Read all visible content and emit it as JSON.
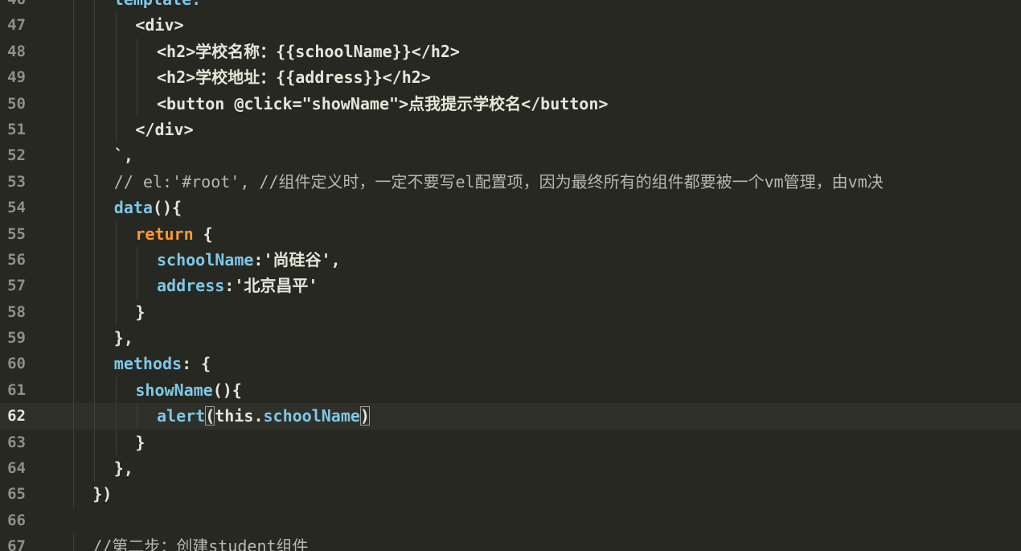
{
  "editor": {
    "active_line": "62",
    "lines": [
      {
        "n": "46",
        "indent": 3,
        "segments": [
          {
            "t": "template:`",
            "c": "prop"
          }
        ]
      },
      {
        "n": "47",
        "indent": 4,
        "segments": [
          {
            "t": "<div>",
            "c": "tag"
          }
        ]
      },
      {
        "n": "48",
        "indent": 5,
        "segments": [
          {
            "t": "<h2>学校名称：{{schoolName}}</h2>",
            "c": "tag"
          }
        ]
      },
      {
        "n": "49",
        "indent": 5,
        "segments": [
          {
            "t": "<h2>学校地址：{{address}}</h2>",
            "c": "tag"
          }
        ]
      },
      {
        "n": "50",
        "indent": 5,
        "segments": [
          {
            "t": "<button @click=\"showName\">点我提示学校名</button>",
            "c": "tag"
          }
        ]
      },
      {
        "n": "51",
        "indent": 4,
        "segments": [
          {
            "t": "</div>",
            "c": "tag"
          }
        ]
      },
      {
        "n": "52",
        "indent": 3,
        "segments": [
          {
            "t": "`,",
            "c": "str"
          }
        ]
      },
      {
        "n": "53",
        "indent": 3,
        "segments": [
          {
            "t": "// el:'#root', //组件定义时，一定不要写el配置项，因为最终所有的组件都要被一个vm管理，由vm决",
            "c": "cmt"
          }
        ]
      },
      {
        "n": "54",
        "indent": 3,
        "segments": [
          {
            "t": "data",
            "c": "fn"
          },
          {
            "t": "(){",
            "c": "tag"
          }
        ]
      },
      {
        "n": "55",
        "indent": 4,
        "segments": [
          {
            "t": "return",
            "c": "kw"
          },
          {
            "t": " {",
            "c": "tag"
          }
        ]
      },
      {
        "n": "56",
        "indent": 5,
        "segments": [
          {
            "t": "schoolName",
            "c": "prop"
          },
          {
            "t": ":'尚硅谷',",
            "c": "str"
          }
        ]
      },
      {
        "n": "57",
        "indent": 5,
        "segments": [
          {
            "t": "address",
            "c": "prop"
          },
          {
            "t": ":'北京昌平'",
            "c": "str"
          }
        ]
      },
      {
        "n": "58",
        "indent": 4,
        "segments": [
          {
            "t": "}",
            "c": "tag"
          }
        ]
      },
      {
        "n": "59",
        "indent": 3,
        "segments": [
          {
            "t": "},",
            "c": "tag"
          }
        ]
      },
      {
        "n": "60",
        "indent": 3,
        "segments": [
          {
            "t": "methods",
            "c": "prop"
          },
          {
            "t": ": {",
            "c": "tag"
          }
        ]
      },
      {
        "n": "61",
        "indent": 4,
        "segments": [
          {
            "t": "showName",
            "c": "fn"
          },
          {
            "t": "(){",
            "c": "tag"
          }
        ]
      },
      {
        "n": "62",
        "indent": 5,
        "segments": [
          {
            "t": "alert",
            "c": "fn"
          },
          {
            "t": "(",
            "c": "tag bracket-hl"
          },
          {
            "t": "this",
            "c": "this"
          },
          {
            "t": ".",
            "c": "tag"
          },
          {
            "t": "schoolName",
            "c": "prop"
          },
          {
            "t": ")",
            "c": "tag bracket-hl"
          }
        ]
      },
      {
        "n": "63",
        "indent": 4,
        "segments": [
          {
            "t": "}",
            "c": "tag"
          }
        ]
      },
      {
        "n": "64",
        "indent": 3,
        "segments": [
          {
            "t": "},",
            "c": "tag"
          }
        ]
      },
      {
        "n": "65",
        "indent": 2,
        "segments": [
          {
            "t": "})",
            "c": "tag"
          }
        ]
      },
      {
        "n": "66",
        "indent": 0,
        "segments": []
      },
      {
        "n": "67",
        "indent": 2,
        "segments": [
          {
            "t": "//第二步：创建student组件",
            "c": "cmt"
          }
        ]
      }
    ]
  }
}
